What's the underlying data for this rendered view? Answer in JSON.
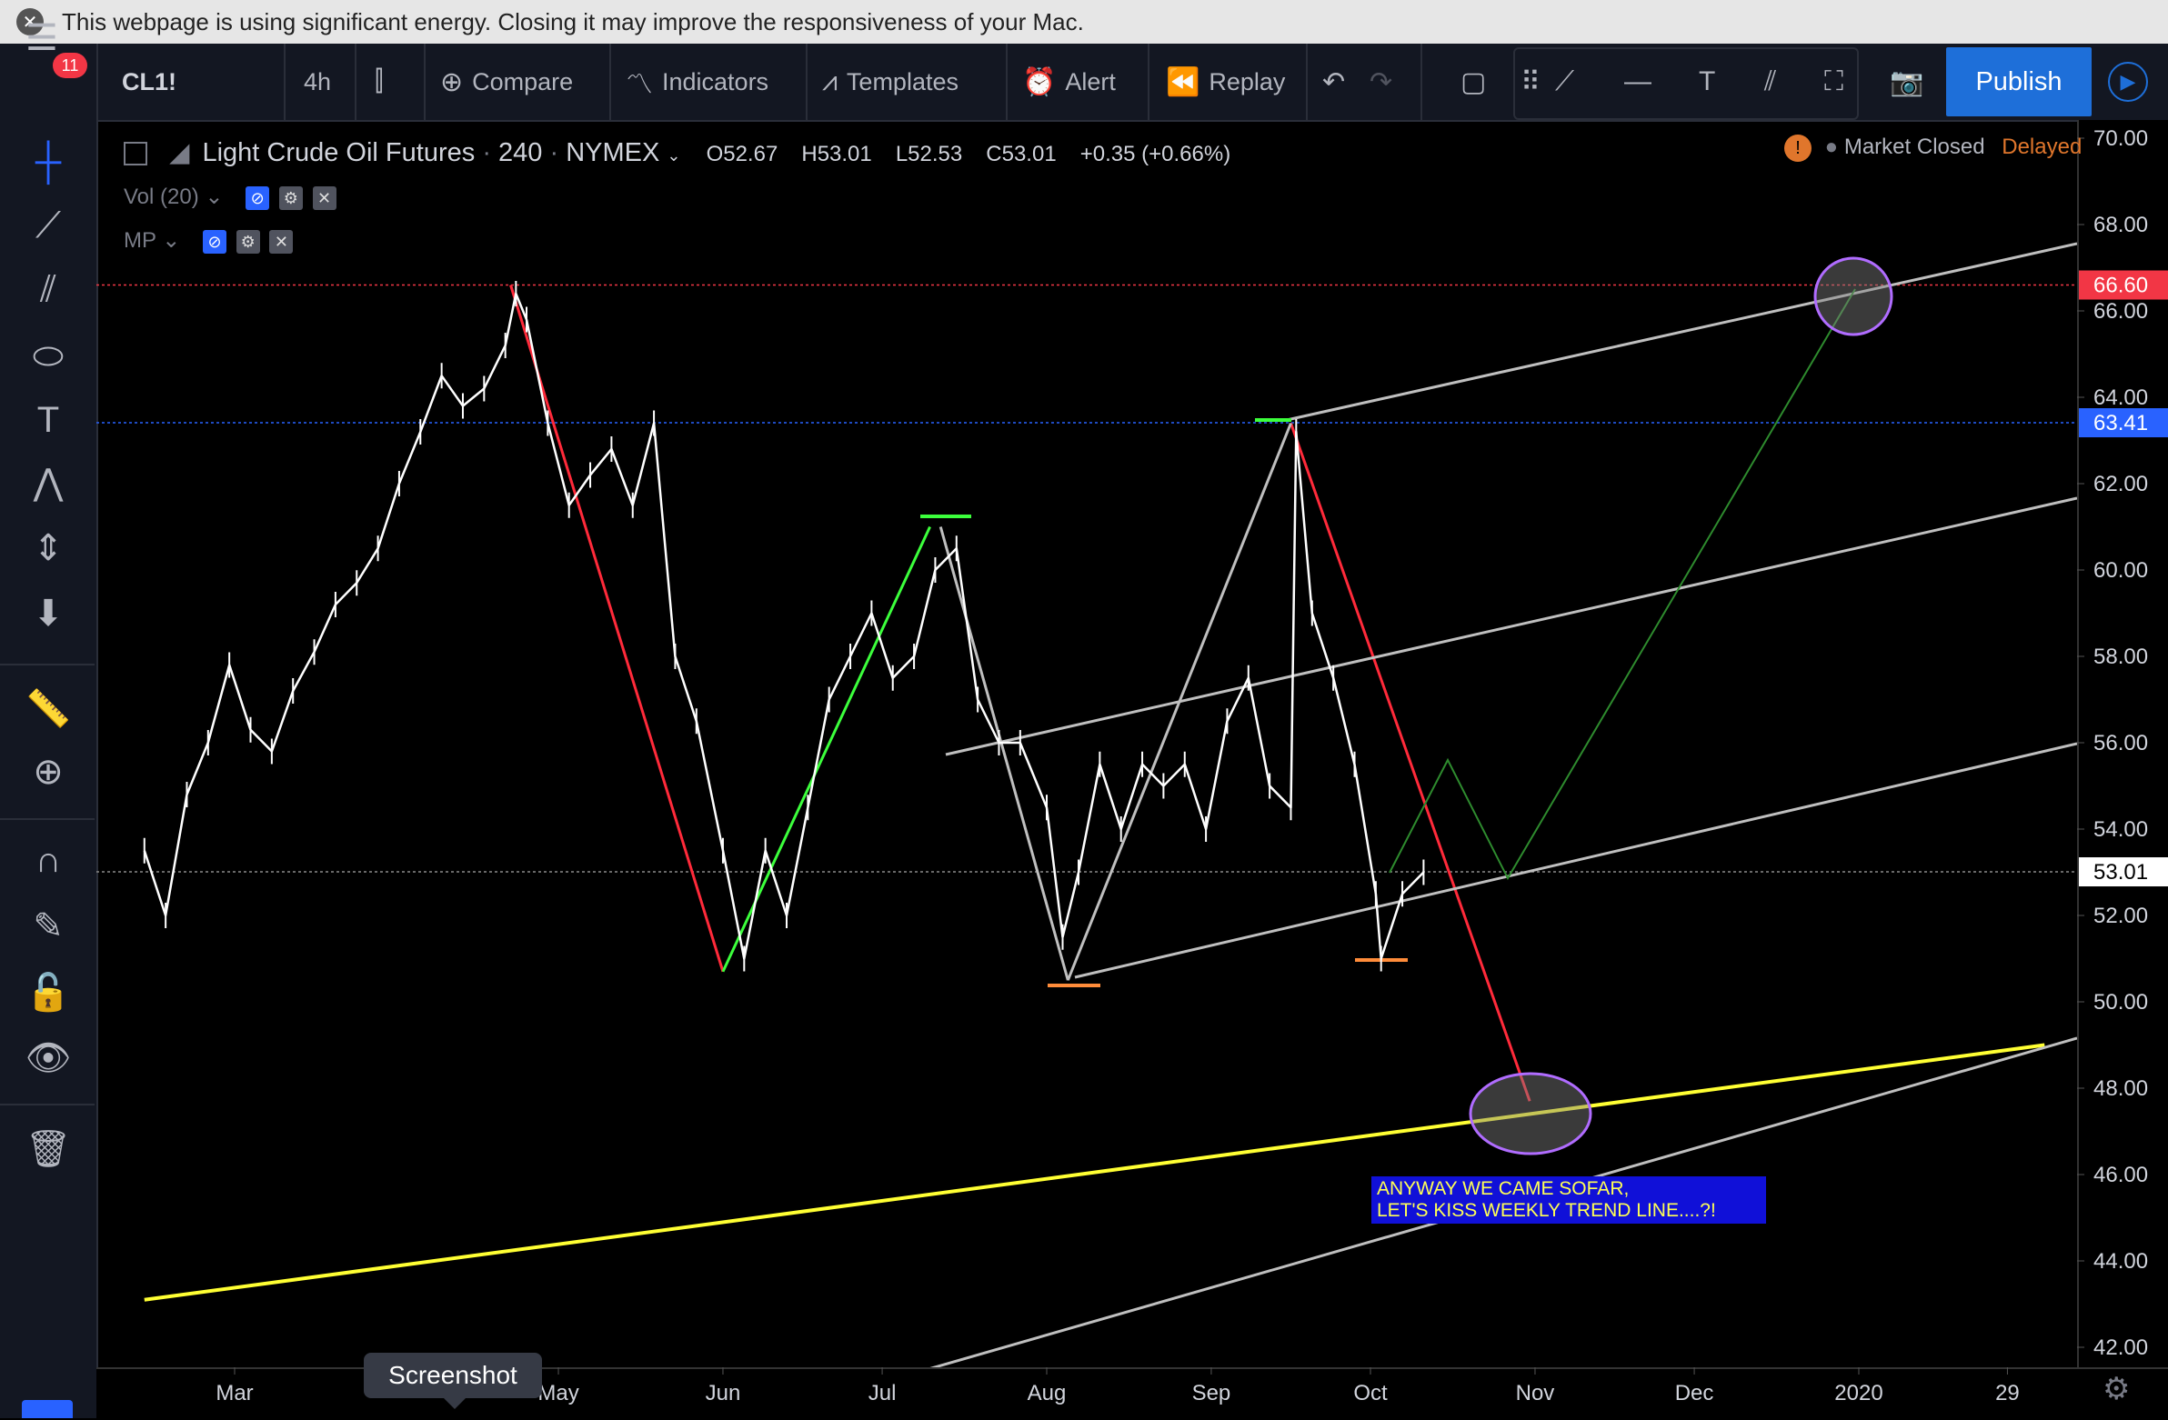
{
  "banner": {
    "text": "This webpage is using significant energy. Closing it may improve the responsiveness of your Mac."
  },
  "toolbar": {
    "menu_badge": "11",
    "symbol": "CL1!",
    "interval": "4h",
    "compare": "Compare",
    "indicators": "Indicators",
    "templates": "Templates",
    "alert": "Alert",
    "replay": "Replay",
    "publish": "Publish"
  },
  "legend": {
    "title": "Light Crude Oil Futures",
    "interval": "240",
    "exchange": "NYMEX",
    "open": "O52.67",
    "high": "H53.01",
    "low": "L52.53",
    "close": "C53.01",
    "change": "+0.35 (+0.66%)",
    "vol": "Vol (20)",
    "mp": "MP"
  },
  "status": {
    "market": "Market Closed",
    "delayed": "Delayed"
  },
  "annotation": "ANYWAY WE CAME SOFAR,\nLET'S KISS WEEKLY TREND LINE....?!",
  "tooltip": "Screenshot",
  "colors": {
    "price": "#ffffff",
    "red_line": "#ff2a3a",
    "green_line": "#3cff3c",
    "grey_line": "#bfbfbf",
    "yellow_line": "#ffff33",
    "axis_text": "#d1d4dc",
    "red_label": "#f23645",
    "blue_label": "#2962ff"
  },
  "chart_data": {
    "type": "line",
    "symbol": "CL1!",
    "interval": "240",
    "ylim": [
      42,
      70
    ],
    "yticks": [
      "70.00",
      "68.00",
      "66.00",
      "64.00",
      "62.00",
      "60.00",
      "58.00",
      "56.00",
      "54.00",
      "52.00",
      "50.00",
      "48.00",
      "46.00",
      "44.00",
      "42.00"
    ],
    "price_labels": [
      {
        "value": 66.6,
        "text": "66.60",
        "color": "#f23645"
      },
      {
        "value": 63.41,
        "text": "63.41",
        "color": "#2962ff"
      },
      {
        "value": 53.01,
        "text": "53.01",
        "color": "#ffffff"
      }
    ],
    "xticks": [
      {
        "label": "Mar",
        "date": "2019-03-01"
      },
      {
        "label": "May",
        "date": "2019-05-01"
      },
      {
        "label": "Jun",
        "date": "2019-06-01"
      },
      {
        "label": "Jul",
        "date": "2019-07-01"
      },
      {
        "label": "Aug",
        "date": "2019-08-01"
      },
      {
        "label": "Sep",
        "date": "2019-09-01"
      },
      {
        "label": "Oct",
        "date": "2019-10-01"
      },
      {
        "label": "Nov",
        "date": "2019-11-01"
      },
      {
        "label": "Dec",
        "date": "2019-12-01"
      },
      {
        "label": "2020",
        "date": "2020-01-01"
      },
      {
        "label": "29",
        "date": "2020-01-29"
      }
    ],
    "series": [
      {
        "x": [
          "2019-02-12",
          "2019-02-16",
          "2019-02-20",
          "2019-02-24",
          "2019-02-28",
          "2019-03-04",
          "2019-03-08",
          "2019-03-12",
          "2019-03-16",
          "2019-03-20",
          "2019-03-24",
          "2019-03-28",
          "2019-04-01",
          "2019-04-05",
          "2019-04-09",
          "2019-04-13",
          "2019-04-17",
          "2019-04-21",
          "2019-04-23",
          "2019-04-25",
          "2019-04-29",
          "2019-05-03",
          "2019-05-07",
          "2019-05-11",
          "2019-05-15",
          "2019-05-19",
          "2019-05-23",
          "2019-05-27",
          "2019-06-01",
          "2019-06-05",
          "2019-06-09",
          "2019-06-13",
          "2019-06-17",
          "2019-06-21",
          "2019-06-25",
          "2019-06-29",
          "2019-07-03",
          "2019-07-07",
          "2019-07-11",
          "2019-07-15",
          "2019-07-19",
          "2019-07-23",
          "2019-07-27",
          "2019-08-01",
          "2019-08-04",
          "2019-08-07",
          "2019-08-11",
          "2019-08-15",
          "2019-08-19",
          "2019-08-23",
          "2019-08-27",
          "2019-08-31",
          "2019-09-04",
          "2019-09-08",
          "2019-09-12",
          "2019-09-16",
          "2019-09-17",
          "2019-09-20",
          "2019-09-24",
          "2019-09-28",
          "2019-10-02",
          "2019-10-03",
          "2019-10-07",
          "2019-10-11"
        ],
        "values": [
          53.5,
          52.0,
          54.8,
          56.0,
          57.8,
          56.3,
          55.8,
          57.2,
          58.1,
          59.2,
          59.7,
          60.5,
          62.0,
          63.2,
          64.5,
          63.8,
          64.2,
          65.2,
          66.4,
          65.8,
          63.4,
          61.5,
          62.2,
          62.8,
          61.5,
          63.4,
          58.0,
          56.5,
          53.5,
          51.0,
          53.5,
          52.0,
          54.5,
          57.0,
          58.0,
          59.0,
          57.5,
          58.0,
          60.0,
          60.5,
          57.0,
          56.0,
          56.0,
          54.5,
          51.5,
          53.0,
          55.5,
          54.0,
          55.5,
          55.0,
          55.5,
          54.0,
          56.5,
          57.5,
          55.0,
          54.5,
          63.2,
          59.0,
          57.5,
          55.5,
          52.5,
          51.0,
          52.5,
          53.0
        ]
      }
    ],
    "drawings": [
      {
        "kind": "red-line",
        "from": [
          "2019-04-22",
          66.6
        ],
        "to": [
          "2019-06-01",
          50.7
        ]
      },
      {
        "kind": "red-line",
        "from": [
          "2019-09-16",
          63.4
        ],
        "to": [
          "2019-10-31",
          47.7
        ]
      },
      {
        "kind": "green-line",
        "from": [
          "2019-06-01",
          50.7
        ],
        "to": [
          "2019-07-10",
          61.0
        ]
      },
      {
        "kind": "grey-line",
        "from": [
          "2019-07-12",
          61.0
        ],
        "to": [
          "2019-08-05",
          50.5
        ]
      },
      {
        "kind": "grey-line",
        "from": [
          "2019-08-05",
          50.5
        ],
        "to": [
          "2019-09-16",
          63.4
        ]
      },
      {
        "kind": "yellow-trend",
        "from": [
          "2019-02-12",
          43.1
        ],
        "to": [
          "2020-02-05",
          49.0
        ]
      }
    ]
  }
}
